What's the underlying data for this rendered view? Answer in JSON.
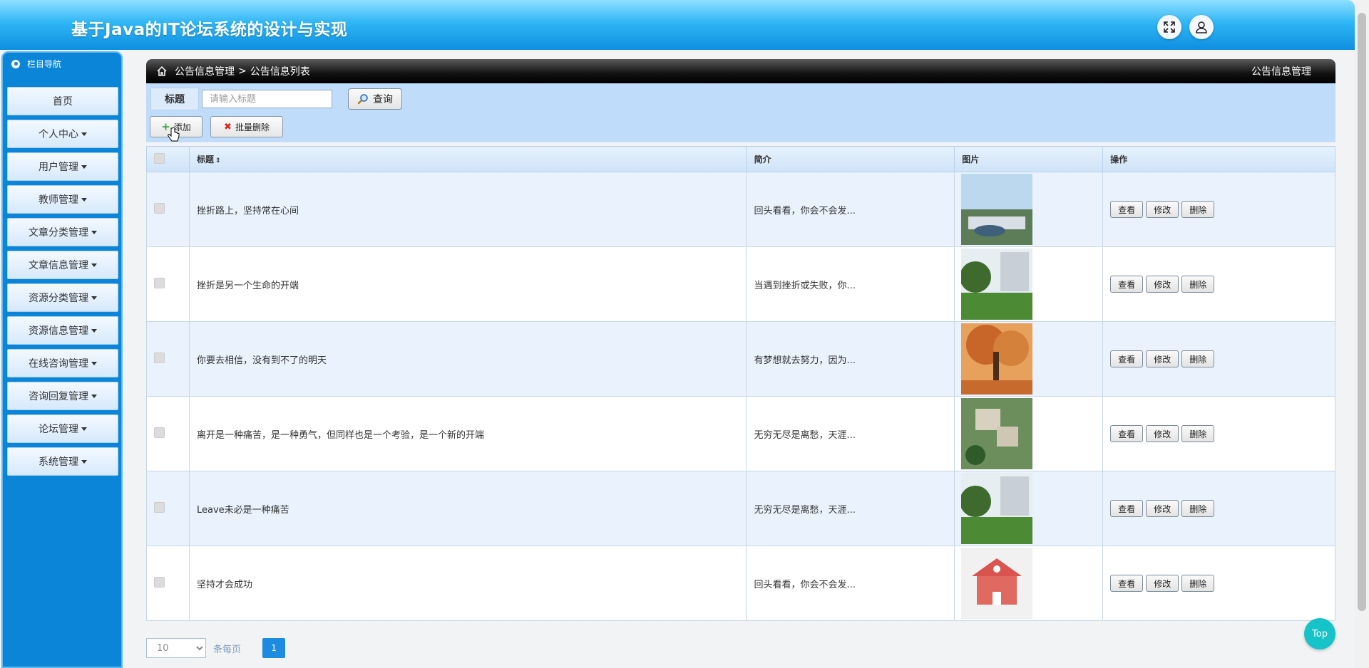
{
  "app": {
    "title": "基于Java的IT论坛系统的设计与实现"
  },
  "sidebar": {
    "header": "栏目导航",
    "items": [
      {
        "label": "首页",
        "has_caret": false
      },
      {
        "label": "个人中心",
        "has_caret": true
      },
      {
        "label": "用户管理",
        "has_caret": true
      },
      {
        "label": "教师管理",
        "has_caret": true
      },
      {
        "label": "文章分类管理",
        "has_caret": true
      },
      {
        "label": "文章信息管理",
        "has_caret": true
      },
      {
        "label": "资源分类管理",
        "has_caret": true
      },
      {
        "label": "资源信息管理",
        "has_caret": true
      },
      {
        "label": "在线咨询管理",
        "has_caret": true
      },
      {
        "label": "咨询回复管理",
        "has_caret": true
      },
      {
        "label": "论坛管理",
        "has_caret": true
      },
      {
        "label": "系统管理",
        "has_caret": true
      }
    ]
  },
  "breadcrumb": {
    "section": "公告信息管理",
    "separator": ">",
    "page": "公告信息列表",
    "right": "公告信息管理"
  },
  "search": {
    "label": "标题",
    "placeholder": "请输入标题",
    "value": "",
    "button": "查询"
  },
  "toolbar": {
    "add": "添加",
    "batch_delete": "批量删除"
  },
  "table": {
    "columns": [
      "",
      "标题",
      "简介",
      "图片",
      "操作"
    ],
    "title_sort_icon": "⇕",
    "actions": [
      "查看",
      "修改",
      "删除"
    ],
    "rows": [
      {
        "title": "挫折路上，坚持常在心间",
        "intro": "回头看看，你会不会发...",
        "image": "campus-aerial-photo"
      },
      {
        "title": "挫折是另一个生命的开端",
        "intro": "当遇到挫折或失败，你...",
        "image": "campus-lawn-photo"
      },
      {
        "title": "你要去相信，没有到不了的明天",
        "intro": "有梦想就去努力，因为...",
        "image": "autumn-tree-photo"
      },
      {
        "title": "离开是一种痛苦，是一种勇气，但同样也是一个考验，是一个新的开端",
        "intro": "无穷无尽是离愁，天涯...",
        "image": "campus-buildings-aerial-photo"
      },
      {
        "title": "Leave未必是一种痛苦",
        "intro": "无穷无尽是离愁，天涯...",
        "image": "campus-lawn-photo"
      },
      {
        "title": "坚持才会成功",
        "intro": "回头看看，你会不会发...",
        "image": "school-building-icon-image"
      }
    ]
  },
  "pagination": {
    "page_size": "10",
    "per_page_label": "条每页",
    "current_page": "1"
  },
  "float": {
    "top_button": "Top"
  },
  "colors": {
    "header_blue": "#2fb6f5",
    "sidebar_blue": "#0a85d8",
    "toolbar_blue": "#bfdcfb",
    "top_button": "#15c3c8"
  }
}
